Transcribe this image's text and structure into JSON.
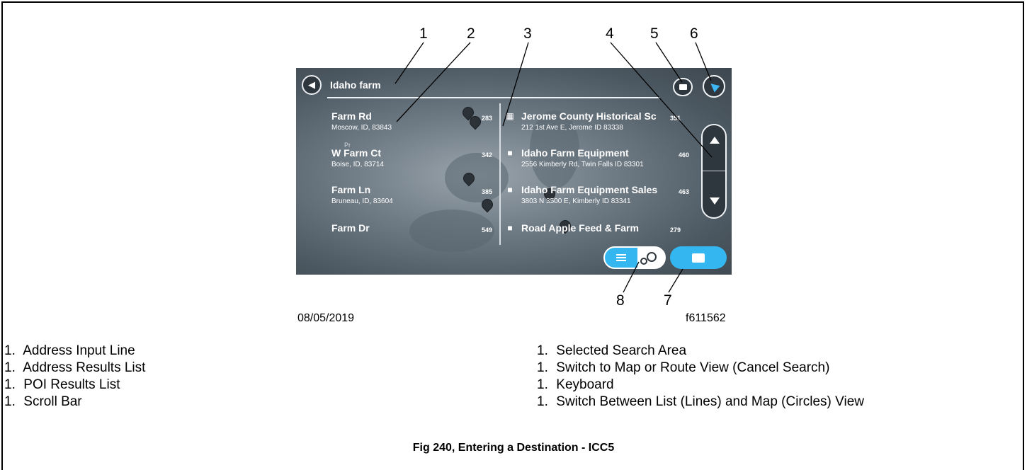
{
  "callouts": [
    "1",
    "2",
    "3",
    "4",
    "5",
    "6",
    "8",
    "7"
  ],
  "date": "08/05/2019",
  "figure_id": "f611562",
  "screen": {
    "search_text": "Idaho farm",
    "addresses": [
      {
        "name": "Farm Rd",
        "sub": "Moscow, ID, 83843",
        "dist": "283"
      },
      {
        "name": "W Farm Ct",
        "sub": "Boise, ID, 83714",
        "dist": "342"
      },
      {
        "name": "Farm Ln",
        "sub": "Bruneau, ID, 83604",
        "dist": "385"
      },
      {
        "name": "Farm Dr",
        "sub": "",
        "dist": "549"
      }
    ],
    "pois": [
      {
        "name": "Jerome County Historical Sc",
        "sub": "212 1st Ave E, Jerome ID 83338",
        "dist": "351"
      },
      {
        "name": "Idaho Farm Equipment",
        "sub": "2556 Kimberly Rd, Twin Falls ID 83301",
        "dist": "460"
      },
      {
        "name": "Idaho Farm Equipment Sales",
        "sub": "3803 N 3500 E, Kimberly ID 83341",
        "dist": "463"
      },
      {
        "name": "Road Apple Feed & Farm",
        "sub": "",
        "dist": "279"
      }
    ],
    "map_label": "Pr"
  },
  "legend": [
    {
      "num": "1.",
      "text": "Address Input Line"
    },
    {
      "num": "1.",
      "text": "Address Results List"
    },
    {
      "num": "1.",
      "text": "POI Results List"
    },
    {
      "num": "1.",
      "text": "Scroll Bar"
    },
    {
      "num": "1.",
      "text": "Selected Search Area"
    },
    {
      "num": "1.",
      "text": "Switch to Map or Route View (Cancel Search)"
    },
    {
      "num": "1.",
      "text": "Keyboard"
    },
    {
      "num": "1.",
      "text": "Switch Between List (Lines) and Map (Circles) View"
    }
  ],
  "caption": "Fig 240, Entering a Destination - ICC5",
  "colors": {
    "accent": "#34b7f0",
    "screen_dark": "#2f373e"
  },
  "icons": [
    "back-arrow-icon",
    "search-area-icon",
    "navigation-arrow-icon",
    "museum-icon",
    "shop-icon",
    "scroll-up-icon",
    "scroll-down-icon",
    "list-view-icon",
    "map-view-icon",
    "keyboard-icon"
  ]
}
